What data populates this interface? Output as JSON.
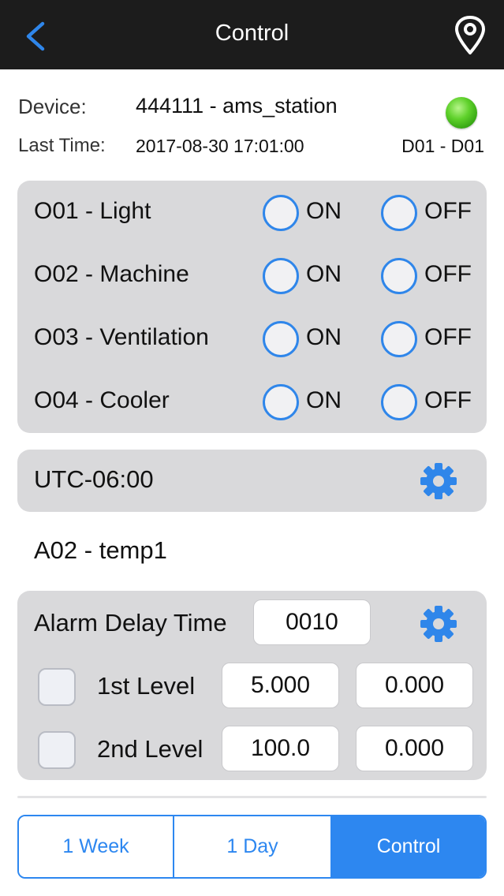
{
  "nav": {
    "title": "Control",
    "back_icon": "chevron-left-icon",
    "location_icon": "map-pin-icon"
  },
  "device": {
    "device_label": "Device:",
    "device_value": "444111 - ams_station",
    "last_time_label": "Last Time:",
    "last_time_value": "2017-08-30  17:01:00",
    "channel": "D01 - D01",
    "status_color": "#4cc41e"
  },
  "outputs": [
    {
      "label": "O01 - Light",
      "on": "ON",
      "off": "OFF"
    },
    {
      "label": "O02 - Machine",
      "on": "ON",
      "off": "OFF"
    },
    {
      "label": "O03 - Ventilation",
      "on": "ON",
      "off": "OFF"
    },
    {
      "label": "O04 - Cooler",
      "on": "ON",
      "off": "OFF"
    }
  ],
  "timezone": {
    "value": "UTC-06:00",
    "icon": "gear-icon"
  },
  "sensor": {
    "title": "A02 - temp1",
    "alarm_delay_label": "Alarm Delay Time",
    "alarm_delay_value": "0010",
    "levels": [
      {
        "label": "1st Level",
        "value1": "5.000",
        "value2": "0.000",
        "checked": false
      },
      {
        "label": "2nd Level",
        "value1": "100.0",
        "value2": "0.000",
        "checked": false
      }
    ]
  },
  "tabs": [
    {
      "label": "1 Week",
      "active": false
    },
    {
      "label": "1 Day",
      "active": false
    },
    {
      "label": "Control",
      "active": true
    }
  ],
  "colors": {
    "accent": "#2d87f0",
    "navbar": "#1c1c1c",
    "panel": "#d9d9db"
  }
}
